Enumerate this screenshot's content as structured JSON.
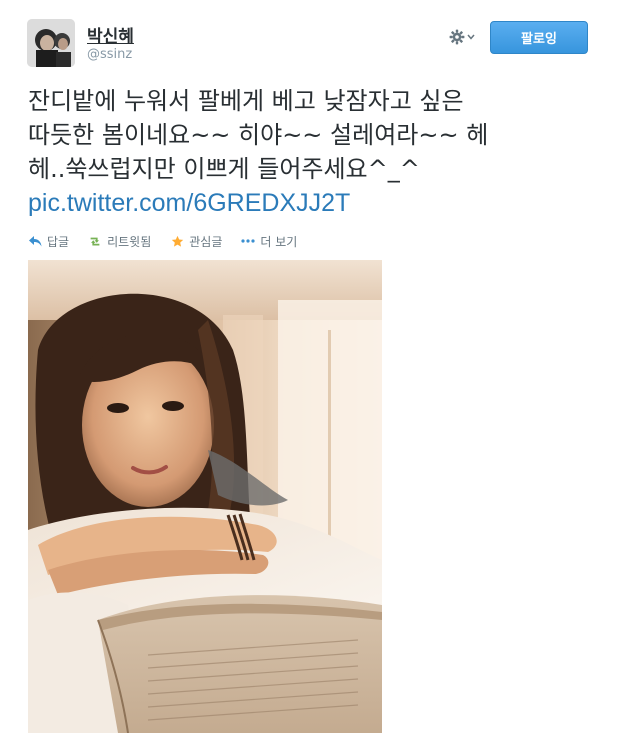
{
  "user": {
    "display_name": "박신혜",
    "username": "@ssinz"
  },
  "buttons": {
    "follow_label": "팔로잉"
  },
  "tweet": {
    "line1": "잔디밭에 누워서 팔베게 베고 낮잠자고 싶은",
    "line2": "따듯한 봄이네요~~ 히야~~ 설레여라~~ 헤",
    "line3": "헤..쑥쓰럽지만 이쁘게 들어주세요^_^",
    "link": "pic.twitter.com/6GREDXJJ2T"
  },
  "actions": {
    "reply": "답글",
    "retweet": "리트윗됨",
    "favorite": "관심글",
    "more": "더 보기"
  },
  "colors": {
    "link": "#2b7bb9",
    "retweet_green": "#77b255",
    "favorite_orange": "#ffac33",
    "follow_blue": "#3795dd"
  },
  "icons": [
    "gear-icon",
    "chevron-down-icon",
    "reply-icon",
    "retweet-icon",
    "star-icon",
    "more-icon"
  ]
}
